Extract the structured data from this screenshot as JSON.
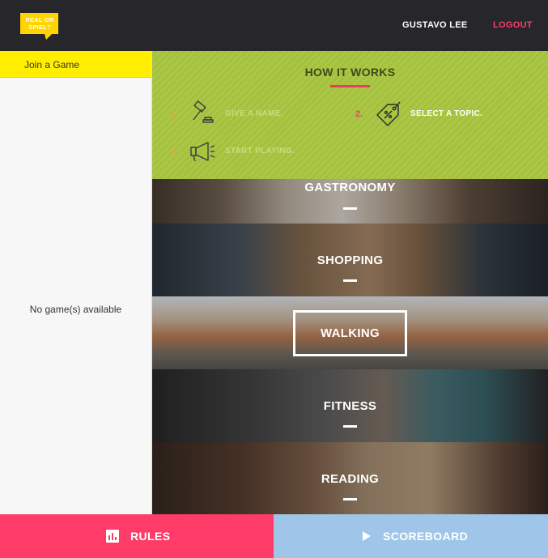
{
  "header": {
    "logo_line1": "REAL OR",
    "logo_line2": "SPIEL?",
    "user_name": "GUSTAVO LEE",
    "logout_label": "LOGOUT",
    "background_color": "#27272b",
    "logo_color": "#ffd400"
  },
  "sidebar": {
    "join_label": "Join a Game",
    "empty_text": "No game(s) available",
    "join_color": "#ffee00"
  },
  "how_it_works": {
    "title": "HOW IT WORKS",
    "background_color": "#a7c43e",
    "steps": [
      {
        "number": "1.",
        "label": "GIVE A NAME.",
        "icon": "gavel-icon",
        "active": false
      },
      {
        "number": "2.",
        "label": "SELECT A TOPIC.",
        "icon": "price-tag-icon",
        "active": true
      },
      {
        "number": "3.",
        "label": "START PLAYING.",
        "icon": "megaphone-icon",
        "active": false
      }
    ]
  },
  "topics": [
    {
      "label": "GASTRONOMY",
      "selected": false
    },
    {
      "label": "SHOPPING",
      "selected": false
    },
    {
      "label": "WALKING",
      "selected": true
    },
    {
      "label": "FITNESS",
      "selected": false
    },
    {
      "label": "READING",
      "selected": false
    }
  ],
  "footer": {
    "rules_label": "RULES",
    "rules_icon": "bar-chart-icon",
    "rules_color": "#ff3c68",
    "scoreboard_label": "SCOREBOARD",
    "scoreboard_icon": "play-icon",
    "scoreboard_color": "#9fc6e8"
  }
}
